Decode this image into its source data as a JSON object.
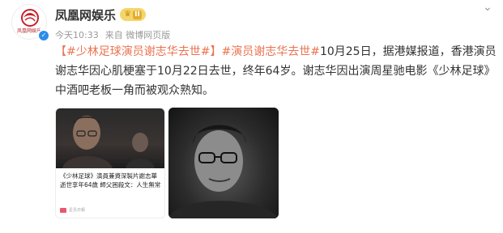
{
  "account": {
    "name": "凤凰网娱乐",
    "level": "II",
    "logo_text": "凤凰网娱乐"
  },
  "meta": {
    "time": "今天10:33",
    "source": "来自 微博网页版"
  },
  "post": {
    "topic1": "【#少林足球演员谢志华去世#】",
    "topic2": "#演员谢志华去世#",
    "body": "10月25日，据港媒报道，香港演员谢志华因心肌梗塞于10月22日去世，终年64岁。谢志华因出演周星驰电影《少林足球》中酒吧老板一角而被观众熟知。"
  },
  "images": [
    {
      "caption": "《少林足球》演員兼資深製片謝志華逝世享年64歲 師父困殺文：人生無常",
      "source_mark": "星島日報"
    },
    {}
  ],
  "colors": {
    "topic": "#eb7350",
    "verified": "#2a8dea",
    "badge": "#f5d56a"
  },
  "icons": [
    "phoenix-logo-icon",
    "verified-icon",
    "crown-icon",
    "chevron-down-icon"
  ]
}
